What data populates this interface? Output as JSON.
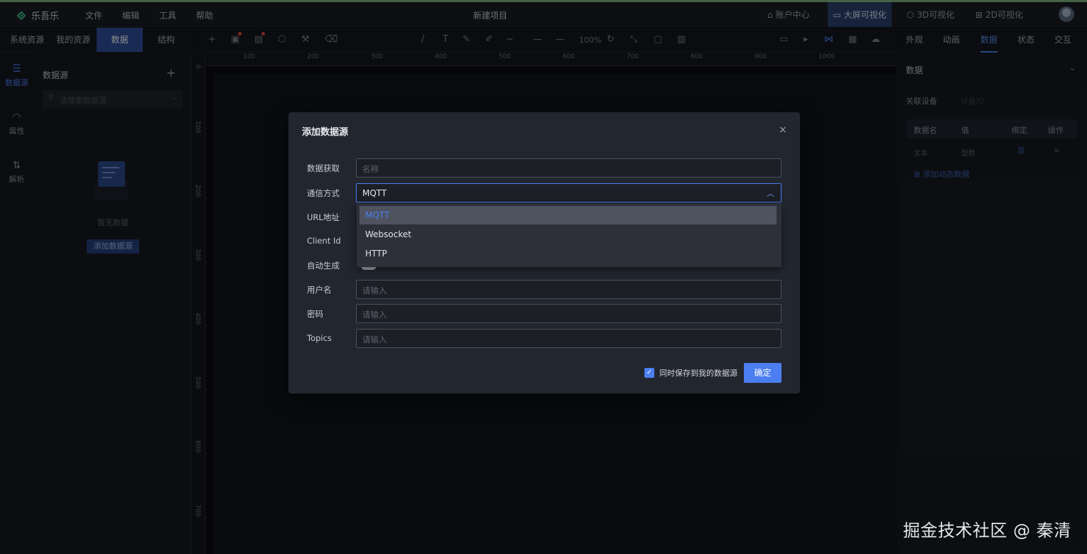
{
  "app": {
    "name": "乐吾乐",
    "project_title": "新建项目"
  },
  "menu": [
    "文件",
    "编辑",
    "工具",
    "帮助"
  ],
  "top_nav": {
    "account": "账户中心",
    "bigscreen": "大屏可视化",
    "threed": "3D可视化",
    "twod": "2D可视化"
  },
  "left_tabs": [
    "系统资源",
    "我的资源",
    "数据",
    "结构"
  ],
  "rail": [
    "数据源",
    "属性",
    "解析"
  ],
  "left_panel": {
    "title": "数据源",
    "add": "+",
    "search_placeholder": "请搜索数据源",
    "empty_text": "暂无数据",
    "add_button": "添加数据源"
  },
  "toolbar": {
    "zoom": "100%"
  },
  "ruler_h": [
    "100",
    "200",
    "300",
    "400",
    "500",
    "600",
    "700",
    "800",
    "900",
    "1000"
  ],
  "ruler_v": [
    "0",
    "100",
    "200",
    "300",
    "400",
    "500",
    "600",
    "700"
  ],
  "right_tabs": [
    "外观",
    "动画",
    "数据",
    "状态",
    "交互"
  ],
  "right_panel": {
    "section": "数据",
    "device_label": "关联设备",
    "device_placeholder": "设备ID",
    "table_headers": [
      "数据名",
      "值",
      "绑定",
      "操作"
    ],
    "row": {
      "name": "文本",
      "value": "型数"
    },
    "add_dynamic": "添加动态数据"
  },
  "modal": {
    "title": "添加数据源",
    "close": "×",
    "fields": {
      "name_label": "数据获取",
      "name_placeholder": "名称",
      "comm_label": "通信方式",
      "comm_value": "MQTT",
      "url_label": "URL地址",
      "client_label": "Client Id",
      "auto_label": "自动生成",
      "user_label": "用户名",
      "user_placeholder": "请输入",
      "pwd_label": "密码",
      "pwd_placeholder": "请输入",
      "topics_label": "Topics",
      "topics_placeholder": "请输入"
    },
    "dropdown_options": [
      "MQTT",
      "Websocket",
      "HTTP"
    ],
    "save_checkbox_label": "同时保存到我的数据源",
    "ok": "确定"
  },
  "watermark": "掘金技术社区 @ 秦清",
  "colors": {
    "accent": "#4b7ef0",
    "bg": "#0f1117",
    "modal": "#22262f"
  }
}
